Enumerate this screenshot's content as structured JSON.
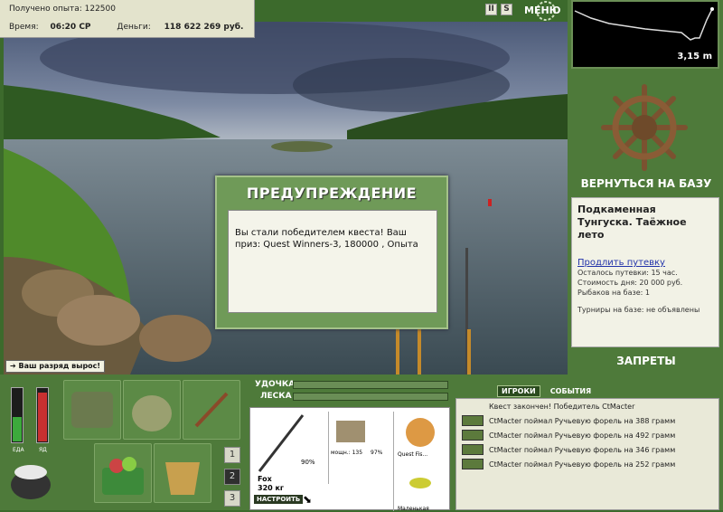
{
  "hud": {
    "xp_label": "Получено опыта:",
    "xp_value": "122500",
    "time_label": "Время:",
    "time_value": "06:20 СР",
    "money_label": "Деньги:",
    "money_value": "118 622 269 руб."
  },
  "controls": {
    "pause_label": "II",
    "sound_label": "S",
    "menu_label": "МЕНЮ"
  },
  "depth": {
    "value": "3,15 m"
  },
  "base": {
    "return_label": "ВЕРНУТЬСЯ НА БАЗУ"
  },
  "location": {
    "title": "Подкаменная Тунгуска. Таёжное лето",
    "buy_link": "Продлить путевку",
    "remaining": "Осталось путевки: 15 час.",
    "day_cost": "Стоимость дня: 20 000 руб.",
    "fishers": "Рыбаков на базе: 1",
    "tournaments": "Турниры на базе: не объявлены"
  },
  "bans": {
    "label": "ЗАПРЕТЫ"
  },
  "dialog": {
    "title": "ПРЕДУПРЕЖДЕНИЕ",
    "text": "Вы стали победителем квеста! Ваш приз: Quest Winners-3, 180000 , Опыта"
  },
  "toast": {
    "text": "Ваш разряд вырос!"
  },
  "meters": {
    "food_label": "ЕДА",
    "poison_label": "ЯД",
    "food_level": 0.45,
    "poison_level": 0.9
  },
  "slots": {
    "numbers": [
      "1",
      "2",
      "3"
    ],
    "active": "2"
  },
  "rod": {
    "rod_label": "УДОЧКА",
    "line_label": "ЛЕСКА",
    "rod_name": "Fox",
    "rod_weight": "320 кг",
    "rod_percent": "90%",
    "reel_power": "мощн.: 135",
    "reel_percent": "97%",
    "line_name": "Quest Fis...",
    "lure_name": "Маленькая",
    "setup_label": "НАСТРОИТЬ"
  },
  "events": {
    "tab_players": "ИГРОКИ",
    "tab_events": "СОБЫТИЯ",
    "items": [
      "Квест закончен! Победитель CtMacter",
      "CtMacter поймал Ручьевую форель на 388 грамм",
      "CtMacter поймал Ручьевую форель на 492 грамм",
      "CtMacter поймал Ручьевую форель на 346 грамм",
      "CtMacter поймал Ручьевую форель на 252 грамм"
    ]
  }
}
